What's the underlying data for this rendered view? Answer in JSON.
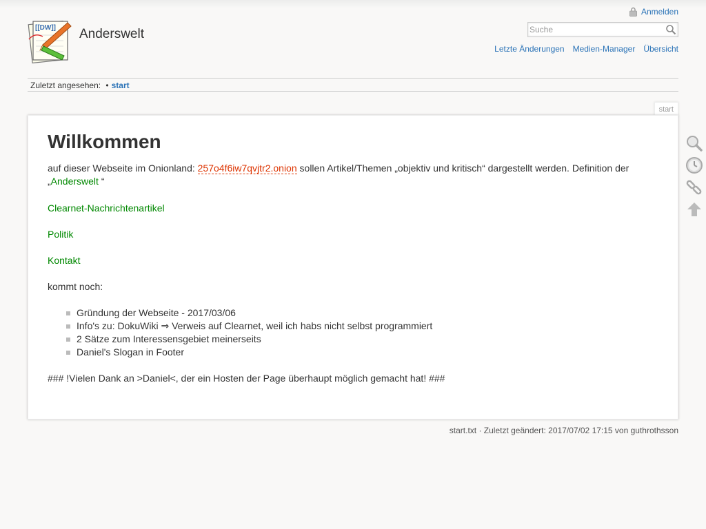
{
  "site": {
    "title": "Anderswelt",
    "logo_text": "[[DW]]"
  },
  "header": {
    "login_label": "Anmelden",
    "search_placeholder": "Suche",
    "search_value": "",
    "usertools": [
      "Letzte Änderungen",
      "Medien-Manager",
      "Übersicht"
    ]
  },
  "breadcrumbs": {
    "label": "Zuletzt angesehen:",
    "separator": "•",
    "items": [
      "start"
    ]
  },
  "page": {
    "id": "start",
    "heading": "Willkommen",
    "intro_before": "auf dieser Webseite im Onionland:",
    "onion_link": "257o4f6iw7qvjtr2.onion",
    "intro_after": "sollen Artikel/Themen „objektiv und kritisch“ dargestellt werden. Definition der „",
    "anderswelt_link": "Anderswelt",
    "intro_end": " “",
    "links": [
      "Clearnet-Nachrichtenartikel",
      "Politik",
      "Kontakt"
    ],
    "upcoming_label": "kommt noch:",
    "todo_items": [
      "Gründung der Webseite - 2017/03/06",
      "Info's zu: DokuWiki ⇒ Verweis auf Clearnet, weil ich habs nicht selbst programmiert",
      "2 Sätze zum Interessensgebiet meinerseits",
      "Daniel's Slogan in Footer"
    ],
    "thanks": "### !Vielen Dank an >Daniel<, der ein Hosten der Page überhaupt möglich gemacht hat! ###"
  },
  "docinfo": "start.txt · Zuletzt geändert: 2017/07/02 17:15 von guthrothsson",
  "pagetools": [
    "search-icon",
    "history-icon",
    "backlinks-icon",
    "back-to-top-icon"
  ],
  "colors": {
    "link": "#2b73b7",
    "wikilink": "#008800",
    "external": "#dd3300",
    "background": "#f9f8f7"
  }
}
